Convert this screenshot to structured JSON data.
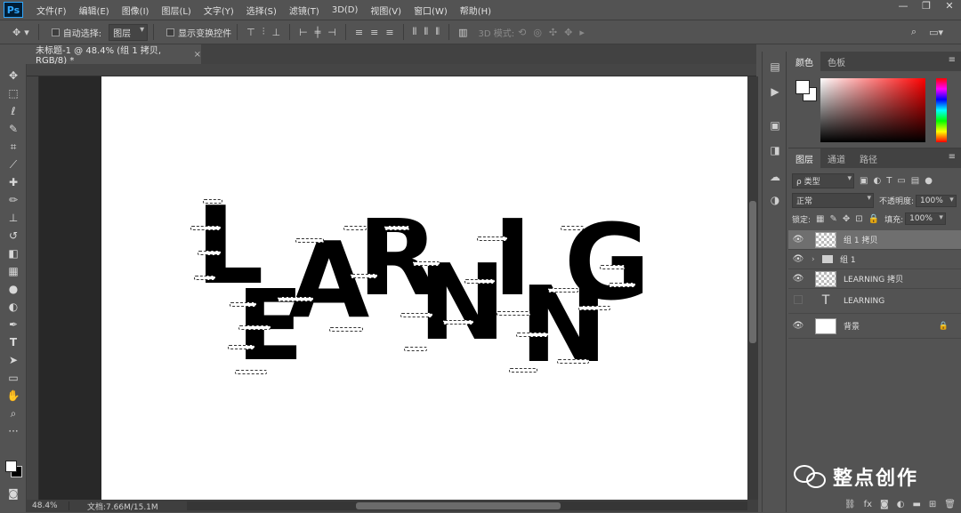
{
  "app": {
    "logo": "Ps"
  },
  "menu": [
    "文件(F)",
    "编辑(E)",
    "图像(I)",
    "图层(L)",
    "文字(Y)",
    "选择(S)",
    "滤镜(T)",
    "3D(D)",
    "视图(V)",
    "窗口(W)",
    "帮助(H)"
  ],
  "window_controls": {
    "minimize": "—",
    "restore": "❐",
    "close": "✕"
  },
  "options": {
    "auto_select_label": "自动选择:",
    "auto_select_value": "图层",
    "show_transform_label": "显示变换控件",
    "mode_3d_label": "3D 模式:"
  },
  "document": {
    "tab_title": "未标题-1 @ 48.4% (组 1 拷贝, RGB/8) *",
    "tab_close": "×",
    "canvas_text": [
      "L",
      "E",
      "A",
      "R",
      "N",
      "I",
      "N",
      "G"
    ]
  },
  "status": {
    "zoom": "48.4%",
    "doc_size": "文档:7.66M/15.1M"
  },
  "color_panel": {
    "tabs": [
      "颜色",
      "色板"
    ],
    "fg": "#ffffff",
    "bg": "#ffffff"
  },
  "layers_panel": {
    "tabs": [
      "图层",
      "通道",
      "路径"
    ],
    "filter_kind": "ρ 类型",
    "blend_mode": "正常",
    "opacity_label": "不透明度:",
    "opacity_value": "100%",
    "lock_label": "锁定:",
    "fill_label": "填充:",
    "fill_value": "100%",
    "layers": [
      {
        "name": "组 1 拷贝",
        "visible": true,
        "selected": true
      },
      {
        "name": "组 1",
        "visible": true
      },
      {
        "name": "LEARNING 拷贝",
        "visible": true
      },
      {
        "name": "LEARNING",
        "visible": false
      },
      {
        "name": "背景",
        "visible": true,
        "locked": true
      }
    ]
  },
  "watermark": {
    "text": "整点创作"
  }
}
